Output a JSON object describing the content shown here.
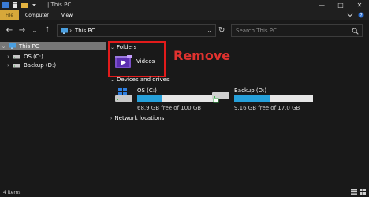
{
  "window": {
    "title": "| This PC",
    "controls": {
      "minimize": "—",
      "maximize": "□",
      "close": "✕"
    }
  },
  "ribbon": {
    "tabs": [
      "File",
      "Computer",
      "View"
    ],
    "collapse_icon": "chevron-down-icon",
    "help_icon": "help-icon"
  },
  "nav": {
    "back": "←",
    "forward": "→",
    "recent": "⌄",
    "up": "↑",
    "address_separator": "›",
    "address_path": "This PC",
    "address_dropdown": "⌄",
    "refresh": "↻",
    "search_placeholder": "Search This PC"
  },
  "sidebar": {
    "items": [
      {
        "label": "This PC",
        "icon": "pc-icon",
        "expand": "⌄",
        "selected": true
      },
      {
        "label": "OS (C:)",
        "icon": "drive-icon",
        "expand": "›",
        "selected": false
      },
      {
        "label": "Backup (D:)",
        "icon": "drive-icon",
        "expand": "›",
        "selected": false
      }
    ]
  },
  "groups": {
    "folders": {
      "caret": "⌄",
      "label": "Folders"
    },
    "devices": {
      "caret": "⌄",
      "label": "Devices and drives"
    },
    "network": {
      "caret": "›",
      "label": "Network locations"
    }
  },
  "folders": [
    {
      "label": "Videos",
      "icon": "videos-folder-icon"
    }
  ],
  "annotation": {
    "text": "Remove",
    "color": "#e21b1b"
  },
  "drives": [
    {
      "name": "OS (C:)",
      "free_text": "68.9 GB free of 100 GB",
      "used_fraction": 0.31,
      "icon": "windows-drive-icon"
    },
    {
      "name": "Backup (D:)",
      "free_text": "9.16 GB free of 17.0 GB",
      "used_fraction": 0.46,
      "icon": "backup-drive-icon"
    }
  ],
  "status": {
    "item_count": "4 items"
  },
  "colors": {
    "background": "#191919",
    "accent": "#26a0da",
    "file_tab": "#d6a83a",
    "selection": "#777777"
  }
}
